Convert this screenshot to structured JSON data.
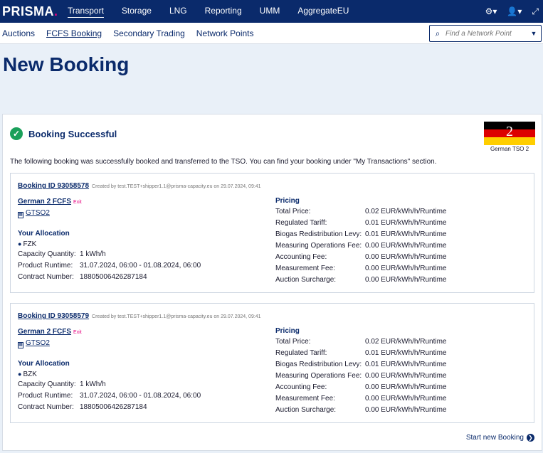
{
  "header": {
    "logo": "PRISMA",
    "logo_dot": ".",
    "nav": [
      "Transport",
      "Storage",
      "LNG",
      "Reporting",
      "UMM",
      "AggregateEU"
    ],
    "icons": [
      "gear-icon",
      "user-icon",
      "expand-icon"
    ]
  },
  "subnav": {
    "items": [
      "Auctions",
      "FCFS Booking",
      "Secondary Trading",
      "Network Points"
    ],
    "search_placeholder": "Find a Network Point"
  },
  "page": {
    "title": "New Booking"
  },
  "result": {
    "status": "Booking Successful",
    "flag_number": "2",
    "flag_label": "German TSO 2",
    "intro": "The following booking was successfully booked and transferred to the TSO. You can find your booking under \"My Transactions\" section."
  },
  "pricing_labels": {
    "heading": "Pricing",
    "total": "Total Price:",
    "tariff": "Regulated Tariff:",
    "biogas": "Biogas Redistribution Levy:",
    "measuring_ops": "Measuring Operations Fee:",
    "accounting": "Accounting Fee:",
    "measurement": "Measurement Fee:",
    "auction_surcharge": "Auction Surcharge:"
  },
  "allocation_labels": {
    "heading": "Your Allocation",
    "capacity": "Capacity Quantity:",
    "runtime": "Product Runtime:",
    "contract": "Contract Number:"
  },
  "bookings": [
    {
      "id": "Booking ID 93058578",
      "meta": "Created by test.TEST+shipper1.1@prisma-capacity.eu on 29.07.2024, 09:41",
      "product": "German 2 FCFS",
      "direction": "Exit",
      "tso": "GTSO2",
      "zone": "FZK",
      "capacity": "1 kWh/h",
      "runtime": "31.07.2024, 06:00 - 01.08.2024, 06:00",
      "contract": "18805006426287184",
      "prices": {
        "total": "0.02 EUR/kWh/h/Runtime",
        "tariff": "0.01 EUR/kWh/h/Runtime",
        "biogas": "0.01 EUR/kWh/h/Runtime",
        "measuring_ops": "0.00 EUR/kWh/h/Runtime",
        "accounting": "0.00 EUR/kWh/h/Runtime",
        "measurement": "0.00 EUR/kWh/h/Runtime",
        "auction_surcharge": "0.00 EUR/kWh/h/Runtime"
      }
    },
    {
      "id": "Booking ID 93058579",
      "meta": "Created by test.TEST+shipper1.1@prisma-capacity.eu on 29.07.2024, 09:41",
      "product": "German 2 FCFS",
      "direction": "Exit",
      "tso": "GTSO2",
      "zone": "BZK",
      "capacity": "1 kWh/h",
      "runtime": "31.07.2024, 06:00 - 01.08.2024, 06:00",
      "contract": "18805006426287184",
      "prices": {
        "total": "0.02 EUR/kWh/h/Runtime",
        "tariff": "0.01 EUR/kWh/h/Runtime",
        "biogas": "0.01 EUR/kWh/h/Runtime",
        "measuring_ops": "0.00 EUR/kWh/h/Runtime",
        "accounting": "0.00 EUR/kWh/h/Runtime",
        "measurement": "0.00 EUR/kWh/h/Runtime",
        "auction_surcharge": "0.00 EUR/kWh/h/Runtime"
      }
    }
  ],
  "actions": {
    "start_new": "Start new Booking"
  },
  "colors": {
    "brand": "#0a2a6b",
    "accent": "#e6007e",
    "success": "#1aa05a"
  }
}
